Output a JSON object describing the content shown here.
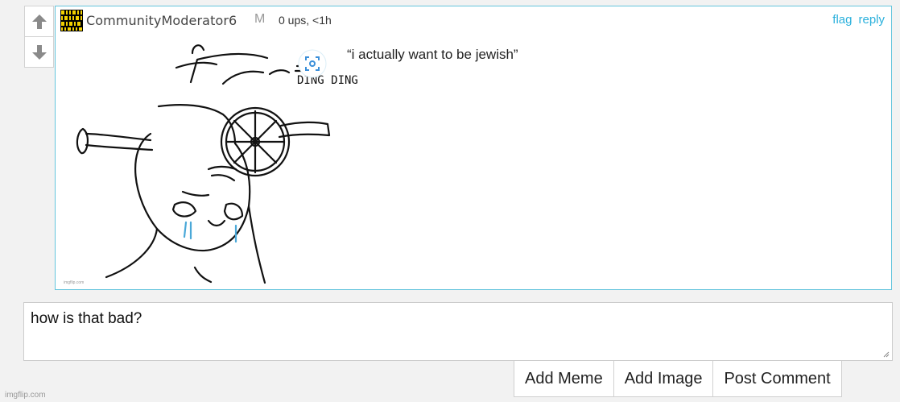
{
  "comment": {
    "username": "CommunityModerator6",
    "mod_badge": "M",
    "meta": "0 ups, <1h",
    "flag_label": "flag",
    "reply_label": "reply",
    "caption": "“i actually want to be jewish”",
    "meme_sound_text": "DING DING",
    "meme_credit": "imgflip.com"
  },
  "reply": {
    "value": "how is that bad?"
  },
  "toolbar": {
    "add_meme": "Add Meme",
    "add_image": "Add Image",
    "post_comment": "Post Comment"
  },
  "watermark": "imgflip.com",
  "colors": {
    "accent": "#2ab0dc",
    "comment_border": "#64c5dd",
    "arrow": "#8a8a8a"
  }
}
